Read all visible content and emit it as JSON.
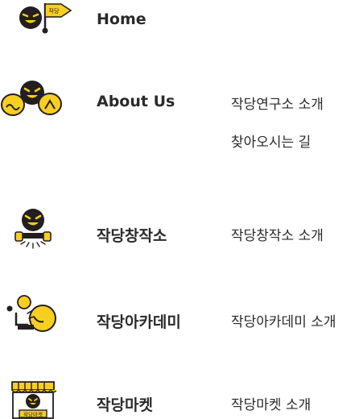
{
  "menu": [
    {
      "label": "Home",
      "icon": "flag-mascot-icon",
      "flag_text": "작당",
      "subs": []
    },
    {
      "label": "About Us",
      "icon": "speech-mascot-icon",
      "subs": [
        "작당연구소 소개",
        "찾아오시는 길"
      ]
    },
    {
      "label": "작당창작소",
      "icon": "studio-mascot-icon",
      "subs": [
        "작당창작소 소개"
      ]
    },
    {
      "label": "작당아카데미",
      "icon": "academy-mascot-icon",
      "subs": [
        "작당아카데미 소개"
      ]
    },
    {
      "label": "작당마켓",
      "icon": "market-mascot-icon",
      "sign_text": "작당마켓",
      "subs": [
        "작당마켓 소개"
      ]
    }
  ],
  "colors": {
    "yellow": "#f7cf21",
    "dark": "#231f20",
    "text": "#2a2a2a"
  }
}
